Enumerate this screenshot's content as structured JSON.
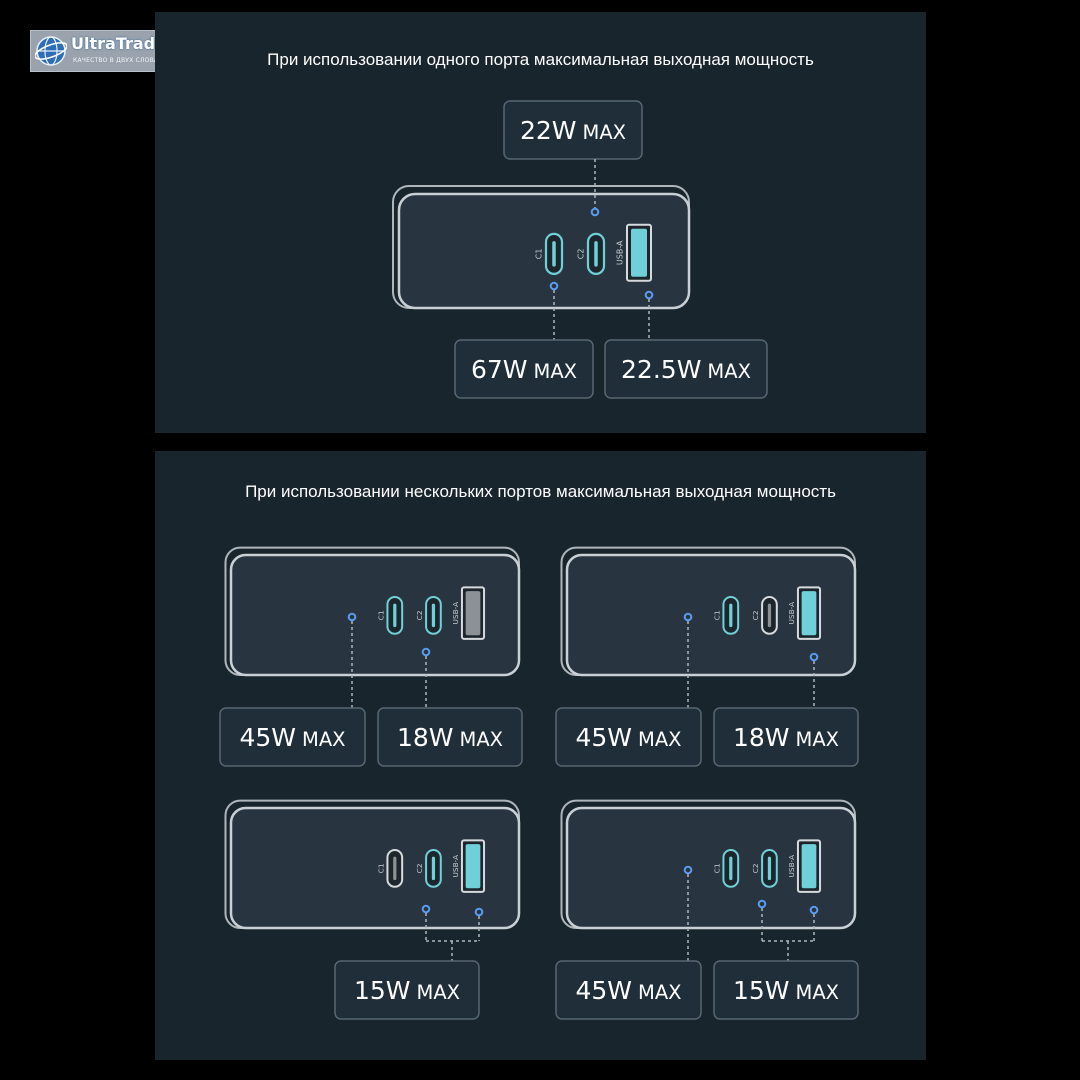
{
  "logo": {
    "brand": "UltraTrade",
    "tagline": "КАЧЕСТВО В ДВУХ СЛОВАХ",
    "icon": "globe-icon"
  },
  "colors": {
    "panel": "#19252d",
    "charger_body": "#283440",
    "accent_active": "#6fd0d8",
    "port_inactive": "#8c9196",
    "dot_blue": "#5b9cf0",
    "label_bg": "#1f2e38"
  },
  "ports": {
    "c1": "C1",
    "c2": "C2",
    "usba": "USB-A"
  },
  "unit": "MAX",
  "single_port": {
    "title": "При использовании одного порта максимальная выходная мощность",
    "labels": [
      "22W",
      "67W",
      "22.5W"
    ]
  },
  "multi_port": {
    "title": "При использовании нескольких портов максимальная выходная мощность",
    "configs": [
      {
        "active": [
          "c1",
          "c2"
        ],
        "labels": [
          "45W",
          "18W"
        ]
      },
      {
        "active": [
          "c1",
          "usba"
        ],
        "labels": [
          "45W",
          "18W"
        ]
      },
      {
        "active": [
          "c2",
          "usba"
        ],
        "labels": [
          "15W"
        ]
      },
      {
        "active": [
          "c1",
          "c2",
          "usba"
        ],
        "labels": [
          "45W",
          "15W"
        ]
      }
    ]
  }
}
